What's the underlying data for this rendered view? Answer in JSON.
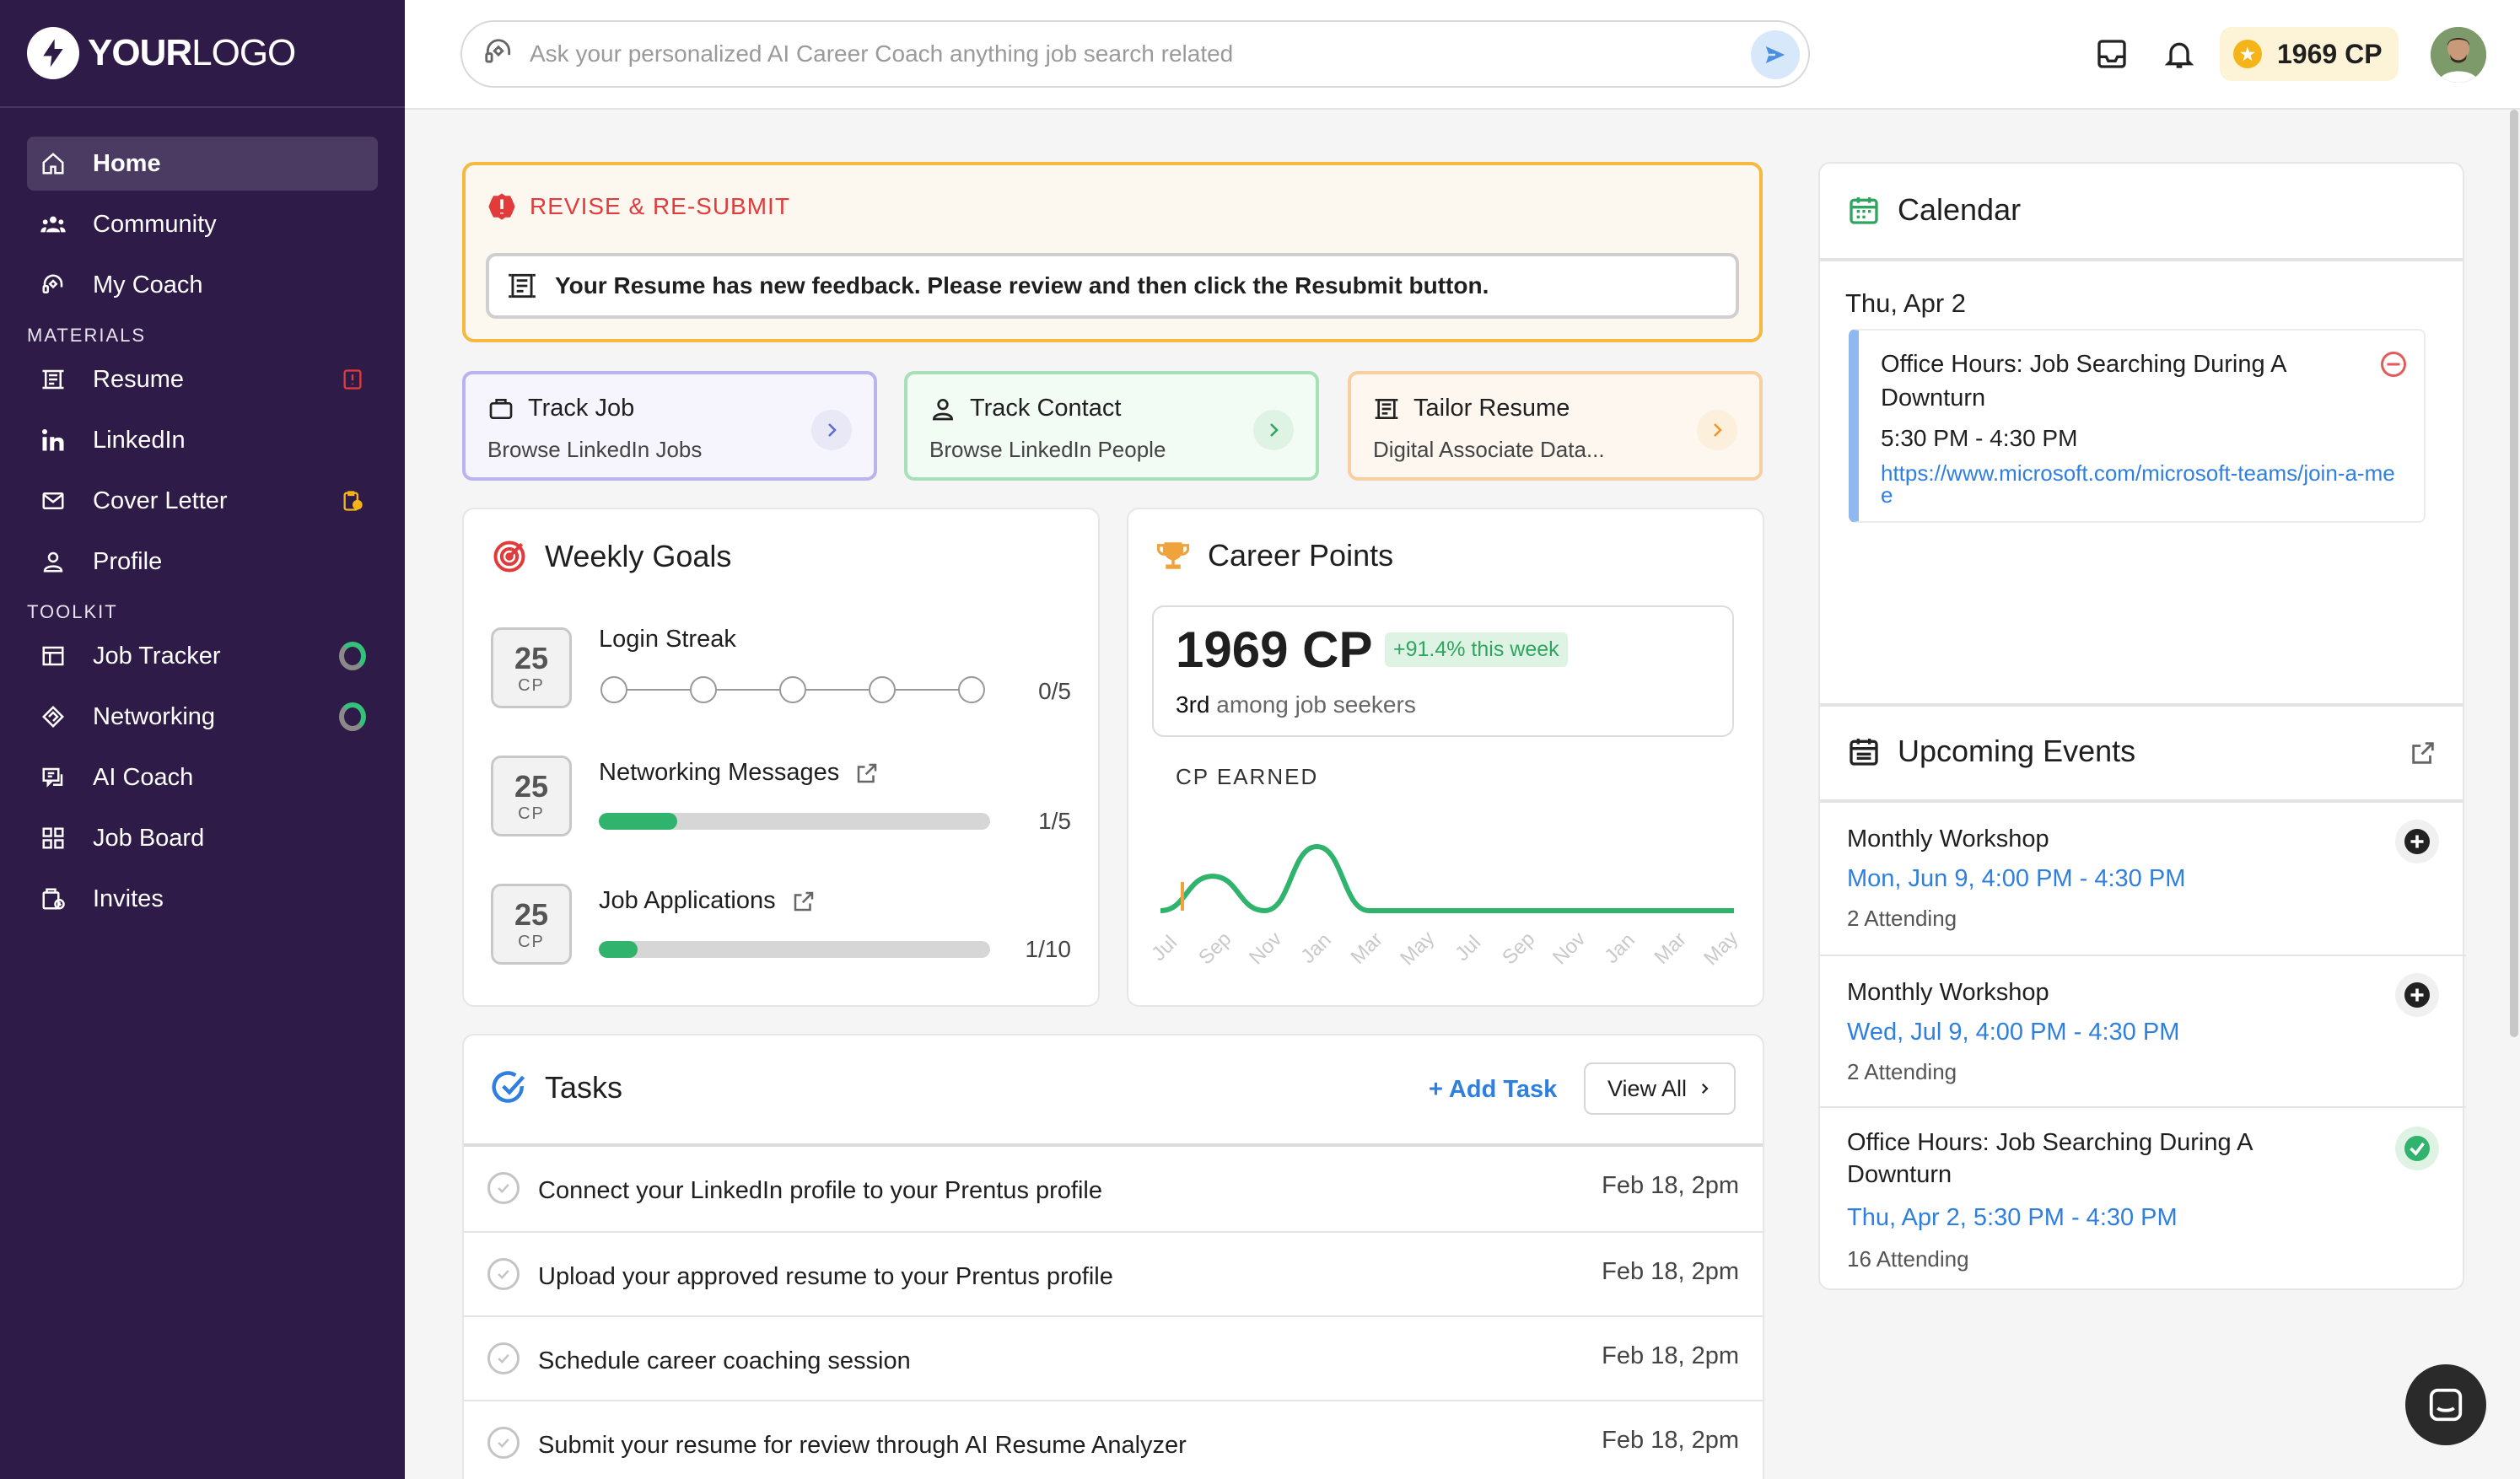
{
  "brand": {
    "logo_bold": "YOUR",
    "logo_thin": "LOGO"
  },
  "sidebar": {
    "items": [
      {
        "label": "Home",
        "icon": "home-icon"
      },
      {
        "label": "Community",
        "icon": "community-icon"
      },
      {
        "label": "My Coach",
        "icon": "coach-icon"
      }
    ],
    "materials_label": "MATERIALS",
    "materials": [
      {
        "label": "Resume",
        "icon": "resume-icon",
        "badge": "alert-badge-icon"
      },
      {
        "label": "LinkedIn",
        "icon": "linkedin-icon"
      },
      {
        "label": "Cover Letter",
        "icon": "cover-letter-icon",
        "badge": "clipboard-badge-icon"
      },
      {
        "label": "Profile",
        "icon": "profile-icon"
      }
    ],
    "toolkit_label": "TOOLKIT",
    "toolkit": [
      {
        "label": "Job Tracker",
        "icon": "job-tracker-icon",
        "badge": "progress-ring-icon"
      },
      {
        "label": "Networking",
        "icon": "networking-icon",
        "badge": "progress-ring-icon"
      },
      {
        "label": "AI Coach",
        "icon": "ai-coach-icon"
      },
      {
        "label": "Job Board",
        "icon": "job-board-icon"
      },
      {
        "label": "Invites",
        "icon": "invites-icon"
      }
    ]
  },
  "topbar": {
    "search_placeholder": "Ask your personalized AI Career Coach anything job search related",
    "cp_value": "1969 CP"
  },
  "revise": {
    "title": "REVISE & RE-SUBMIT",
    "message": "Your Resume has new feedback. Please review and then click the Resubmit button."
  },
  "quick_actions": [
    {
      "title": "Track Job",
      "subtitle": "Browse LinkedIn Jobs",
      "icon": "briefcase-icon",
      "color": "#b9b3ee",
      "bg": "#f6f5fd",
      "arrow_bg": "#e8e8f6",
      "arrow_color": "#5b6bd8"
    },
    {
      "title": "Track Contact",
      "subtitle": "Browse LinkedIn People",
      "icon": "person-icon",
      "color": "#a6e0b7",
      "bg": "#f3fbf5",
      "arrow_bg": "#dff3e5",
      "arrow_color": "#2fa55f"
    },
    {
      "title": "Tailor Resume",
      "subtitle": "Digital Associate Data...",
      "icon": "resume-icon",
      "color": "#f7cfa1",
      "bg": "#fdf7f0",
      "arrow_bg": "#fcefdc",
      "arrow_color": "#f0962b"
    }
  ],
  "weekly_goals": {
    "title": "Weekly Goals",
    "goals": [
      {
        "cp": "25",
        "unit": "CP",
        "label": "Login Streak",
        "count": "0/5",
        "progress": 0,
        "link": false
      },
      {
        "cp": "25",
        "unit": "CP",
        "label": "Networking Messages",
        "count": "1/5",
        "progress": 0.2,
        "link": true
      },
      {
        "cp": "25",
        "unit": "CP",
        "label": "Job Applications",
        "count": "1/10",
        "progress": 0.1,
        "link": true
      }
    ]
  },
  "career_points": {
    "title": "Career Points",
    "value": "1969 CP",
    "change": "+91.4% this week",
    "rank_bold": "3rd",
    "rank_rest": "among job seekers",
    "chart_label": "CP EARNED"
  },
  "chart_data": {
    "type": "line",
    "categories": [
      "Jul",
      "Sep",
      "Nov",
      "Jan",
      "Mar",
      "May",
      "Jul",
      "Sep",
      "Nov",
      "Jan",
      "Mar",
      "May"
    ],
    "series": [
      {
        "values": [
          0,
          14,
          0,
          26,
          0,
          0,
          0,
          0,
          0,
          0,
          0,
          0
        ]
      }
    ],
    "colors": {
      "line": "#2fb36d",
      "marker": "#f0a23c"
    }
  },
  "tasks": {
    "title": "Tasks",
    "add_label": "+ Add Task",
    "view_all_label": "View All",
    "items": [
      {
        "text": "Connect your LinkedIn profile to your Prentus profile",
        "date": "Feb 18, 2pm"
      },
      {
        "text": "Upload your approved resume to your Prentus profile",
        "date": "Feb 18, 2pm"
      },
      {
        "text": "Schedule career coaching session",
        "date": "Feb 18, 2pm"
      },
      {
        "text": "Submit your resume for review through AI Resume Analyzer",
        "date": "Feb 18, 2pm"
      }
    ]
  },
  "calendar": {
    "title": "Calendar",
    "date": "Thu, Apr 2",
    "event": {
      "title": "Office Hours: Job Searching During A Downturn",
      "time": "5:30 PM - 4:30 PM",
      "link": "https://www.microsoft.com/microsoft-teams/join-a-mee"
    }
  },
  "upcoming": {
    "title": "Upcoming Events",
    "events": [
      {
        "title": "Monthly Workshop",
        "time": "Mon, Jun 9, 4:00 PM - 4:30 PM",
        "attending": "2 Attending",
        "status": "add"
      },
      {
        "title": "Monthly Workshop",
        "time": "Wed, Jul 9, 4:00 PM - 4:30 PM",
        "attending": "2 Attending",
        "status": "add"
      },
      {
        "title": "Office Hours: Job Searching During A Downturn",
        "time": "Thu, Apr 2, 5:30 PM - 4:30 PM",
        "attending": "16 Attending",
        "status": "joined"
      }
    ]
  }
}
